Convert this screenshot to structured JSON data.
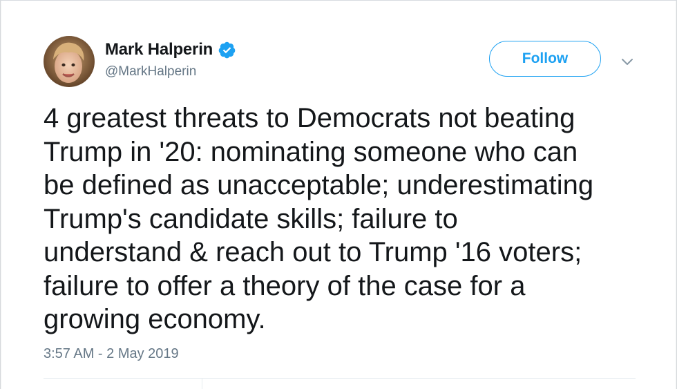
{
  "tweet": {
    "author": {
      "display_name": "Mark Halperin",
      "handle": "@MarkHalperin",
      "verified": true
    },
    "follow_label": "Follow",
    "text_lines": [
      "4 greatest threats to Democrats not beating",
      "Trump in '20: nominating someone who can",
      "be defined as unacceptable; underestimating",
      "Trump's candidate skills; failure to",
      "understand & reach out to Trump '16 voters;",
      "failure to offer a theory of the case for a",
      "growing economy."
    ],
    "timestamp": "3:57 AM - 2 May 2019"
  },
  "icons": {
    "verified": "verified-badge-icon",
    "more": "chevron-down-icon"
  },
  "colors": {
    "accent": "#1da1f2",
    "text": "#14171a",
    "secondary": "#657786"
  }
}
